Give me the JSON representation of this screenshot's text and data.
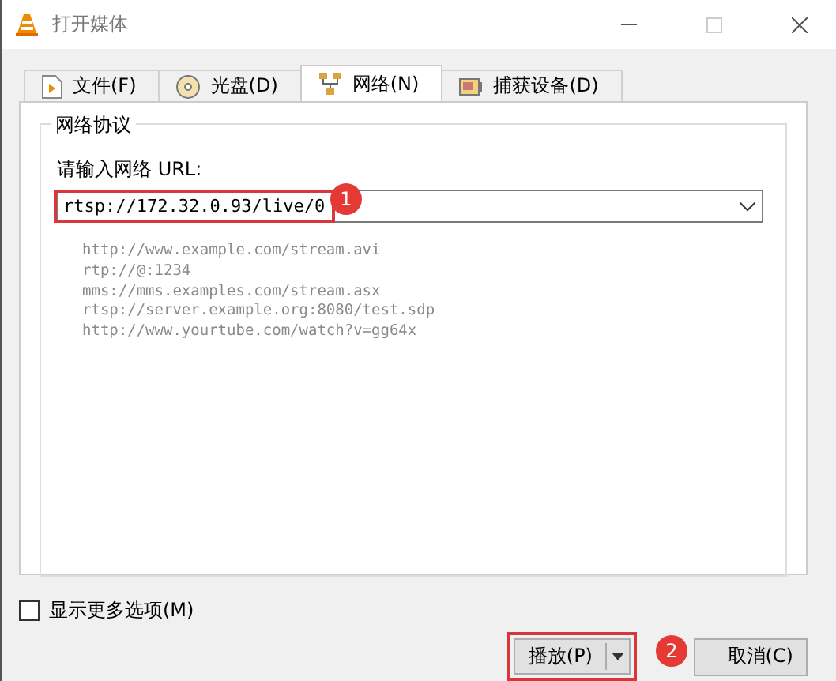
{
  "window": {
    "title": "打开媒体"
  },
  "tabs": [
    {
      "label": "文件(F)",
      "kind": "file",
      "selected": false
    },
    {
      "label": "光盘(D)",
      "kind": "disc",
      "selected": false
    },
    {
      "label": "网络(N)",
      "kind": "network",
      "selected": true
    },
    {
      "label": "捕获设备(D)",
      "kind": "capture",
      "selected": false
    }
  ],
  "group": {
    "title": "网络协议",
    "url_label": "请输入网络 URL:",
    "url_value": "rtsp://172.32.0.93/live/0",
    "examples": [
      "http://www.example.com/stream.avi",
      "rtp://@:1234",
      "mms://mms.examples.com/stream.asx",
      "rtsp://server.example.org:8080/test.sdp",
      "http://www.yourtube.com/watch?v=gg64x"
    ]
  },
  "more_options": {
    "label": "显示更多选项(M)",
    "checked": false
  },
  "buttons": {
    "play": "播放(P)",
    "cancel": "取消(C)"
  },
  "annotations": [
    {
      "label": "1"
    },
    {
      "label": "2"
    }
  ]
}
